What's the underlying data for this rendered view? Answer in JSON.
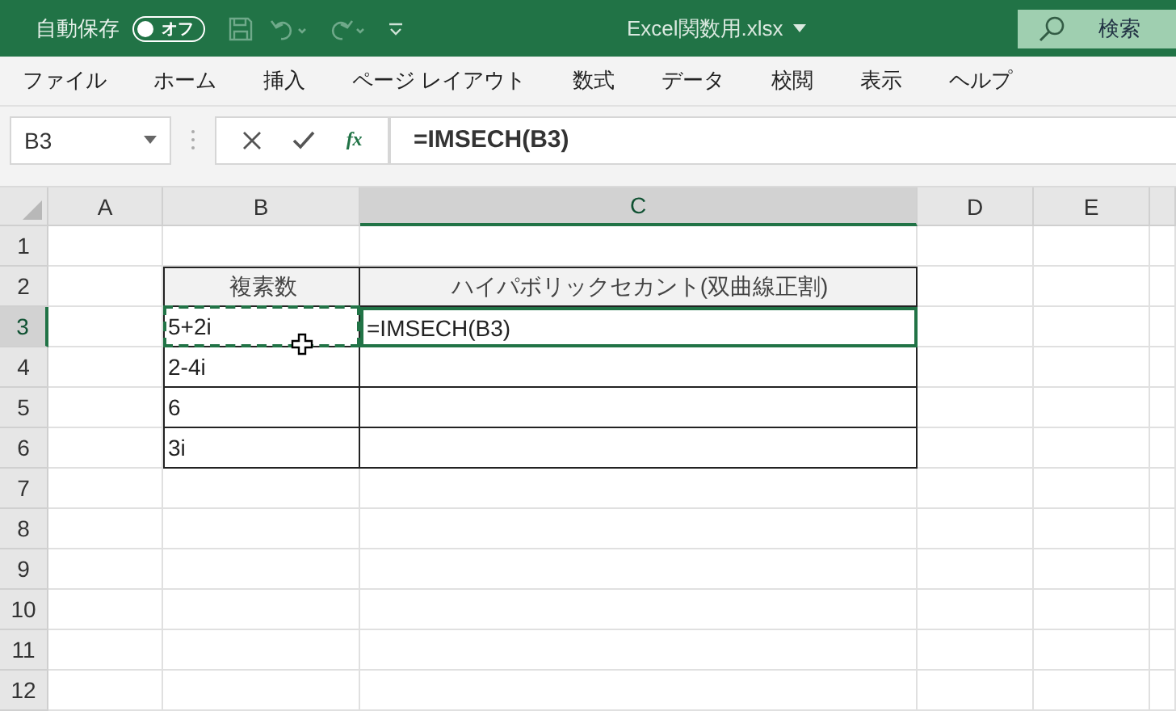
{
  "title_bar": {
    "autosave_label": "自動保存",
    "autosave_toggle": {
      "label": "オフ",
      "on": false
    },
    "file_name": "Excel関数用.xlsx",
    "search": {
      "placeholder": "検索"
    }
  },
  "ribbon_tabs": [
    {
      "label": "ファイル",
      "selected": false
    },
    {
      "label": "ホーム",
      "selected": false
    },
    {
      "label": "挿入",
      "selected": false
    },
    {
      "label": "ページ レイアウト",
      "selected": false
    },
    {
      "label": "数式",
      "selected": false
    },
    {
      "label": "データ",
      "selected": false
    },
    {
      "label": "校閲",
      "selected": false
    },
    {
      "label": "表示",
      "selected": false
    },
    {
      "label": "ヘルプ",
      "selected": false
    }
  ],
  "formula_bar": {
    "name_box": "B3",
    "function_label": "fx",
    "formula": "=IMSECH(B3)"
  },
  "sheet": {
    "columns": [
      {
        "label": "A",
        "selected": false
      },
      {
        "label": "B",
        "selected": false
      },
      {
        "label": "C",
        "selected": true
      },
      {
        "label": "D",
        "selected": false
      },
      {
        "label": "E",
        "selected": false
      }
    ],
    "rows": [
      {
        "label": "1",
        "selected": false
      },
      {
        "label": "2",
        "selected": false
      },
      {
        "label": "3",
        "selected": true
      },
      {
        "label": "4",
        "selected": false
      },
      {
        "label": "5",
        "selected": false
      },
      {
        "label": "6",
        "selected": false
      },
      {
        "label": "7",
        "selected": false
      },
      {
        "label": "8",
        "selected": false
      },
      {
        "label": "9",
        "selected": false
      },
      {
        "label": "10",
        "selected": false
      },
      {
        "label": "11",
        "selected": false
      },
      {
        "label": "12",
        "selected": false
      }
    ],
    "table": [
      [
        {
          "text": "複素数",
          "kind": "header",
          "selected": false,
          "copied": false
        },
        {
          "text": "ハイパボリックセカント(双曲線正割)",
          "kind": "header",
          "selected": false,
          "copied": false
        }
      ],
      [
        {
          "text": "5+2i",
          "kind": "data",
          "selected": false,
          "copied": true
        },
        {
          "text": "=IMSECH(B3)",
          "kind": "data",
          "selected": true,
          "copied": false
        }
      ],
      [
        {
          "text": "2-4i",
          "kind": "data",
          "selected": false,
          "copied": false
        },
        {
          "kind": "data",
          "selected": false,
          "copied": false
        }
      ],
      [
        {
          "text": "6",
          "kind": "data",
          "selected": false,
          "copied": false
        },
        {
          "kind": "data",
          "selected": false,
          "copied": false
        }
      ],
      [
        {
          "text": "3i",
          "kind": "data",
          "selected": false,
          "copied": false
        },
        {
          "kind": "data",
          "selected": false,
          "copied": false
        }
      ]
    ]
  }
}
